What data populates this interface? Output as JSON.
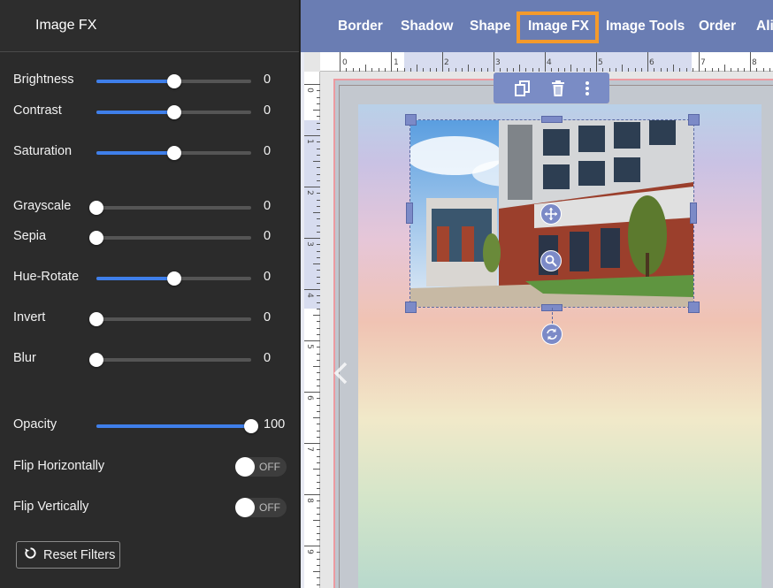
{
  "panel": {
    "title": "Image FX",
    "sliders": [
      {
        "label": "Brightness",
        "value": "0",
        "fraction": 0.5
      },
      {
        "label": "Contrast",
        "value": "0",
        "fraction": 0.5
      },
      {
        "label": "Saturation",
        "value": "0",
        "fraction": 0.5
      },
      {
        "label": "Grayscale",
        "value": "0",
        "fraction": 0
      },
      {
        "label": "Sepia",
        "value": "0",
        "fraction": 0
      },
      {
        "label": "Hue-Rotate",
        "value": "0",
        "fraction": 0.5
      },
      {
        "label": "Invert",
        "value": "0",
        "fraction": 0
      },
      {
        "label": "Blur",
        "value": "0",
        "fraction": 0
      },
      {
        "label": "Opacity",
        "value": "100",
        "fraction": 1
      }
    ],
    "toggles": [
      {
        "label": "Flip Horizontally",
        "state": "OFF"
      },
      {
        "label": "Flip Vertically",
        "state": "OFF"
      }
    ],
    "reset_label": "Reset Filters"
  },
  "toolbar": {
    "items": [
      "Border",
      "Shadow",
      "Shape",
      "Image FX",
      "Image Tools",
      "Order",
      "Ali"
    ],
    "active": "Image FX"
  },
  "ruler": {
    "top_numbers": [
      "0",
      "1",
      "2",
      "3",
      "4",
      "5",
      "6",
      "7",
      "8"
    ],
    "left_numbers": [
      "0",
      "1",
      "2",
      "3",
      "4",
      "5",
      "6",
      "7",
      "8",
      "9"
    ]
  },
  "colors": {
    "accent": "#3f7fea",
    "toolbar": "#6a7db3",
    "active_outline": "#f39a2c",
    "handle": "#7c8ac7"
  },
  "icons": {
    "duplicate": "duplicate-icon",
    "delete": "trash-icon",
    "more": "more-vertical-icon",
    "move": "move-icon",
    "zoom": "zoom-icon",
    "rotate": "rotate-icon",
    "reset": "reset-icon",
    "prev": "chevron-left-icon"
  }
}
